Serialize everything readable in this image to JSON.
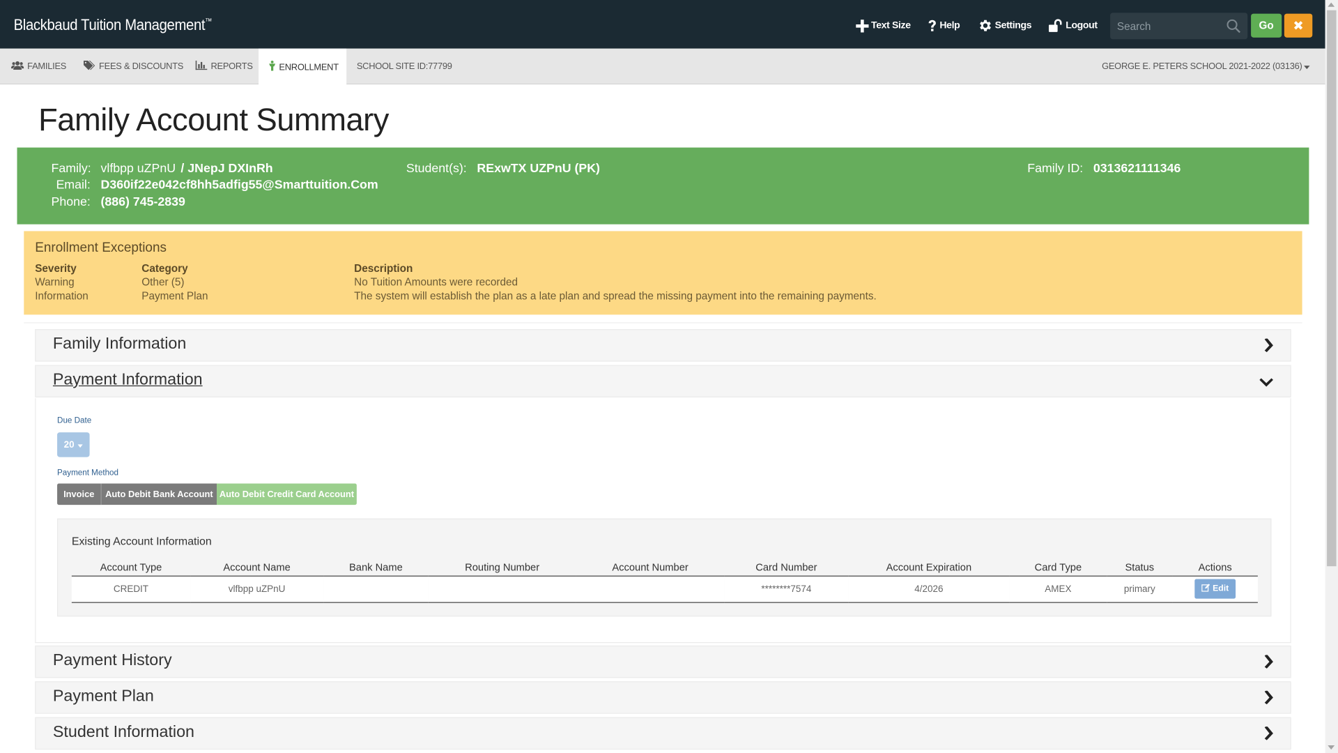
{
  "header": {
    "brand": "Blackbaud Tuition Management",
    "brand_tm": "™",
    "links": {
      "text_size": "Text Size",
      "help": "Help",
      "settings": "Settings",
      "logout": "Logout"
    },
    "search_placeholder": "Search",
    "go_label": "Go",
    "close_label": "✖"
  },
  "nav": {
    "families": "FAMILIES",
    "fees": "FEES & DISCOUNTS",
    "reports": "REPORTS",
    "enrollment": "ENROLLMENT",
    "site_id": "SCHOOL SITE ID:77799",
    "school": "GEORGE E. PETERS SCHOOL 2021-2022 (03136)"
  },
  "page_title": "Family Account Summary",
  "family": {
    "family_label": "Family:",
    "family_value_1": "vlfbpp uZPnU",
    "family_value_2": "/ JNepJ DXInRh",
    "email_label": "Email:",
    "email_value": "D360if22e042cf8hh5adfig55@Smarttuition.Com",
    "phone_label": "Phone:",
    "phone_value": "(886) 745-2839",
    "students_label": "Student(s):",
    "students_value": "RExwTX UZPnU (PK)",
    "family_id_label": "Family ID:",
    "family_id_value": "0313621111346"
  },
  "exceptions": {
    "title": "Enrollment Exceptions",
    "headers": {
      "severity": "Severity",
      "category": "Category",
      "description": "Description"
    },
    "rows": [
      {
        "severity": "Warning",
        "category": "Other (5)",
        "description": "No Tuition Amounts were recorded"
      },
      {
        "severity": "Information",
        "category": "Payment Plan",
        "description": "The system will establish the plan as a late plan and spread the missing payment into the remaining payments."
      }
    ]
  },
  "sections": {
    "family_info": "Family Information",
    "payment_info": "Payment Information",
    "payment_history": "Payment History",
    "payment_plan": "Payment Plan",
    "student_info": "Student Information"
  },
  "payment": {
    "due_date_label": "Due Date",
    "due_date_value": "20",
    "method_label": "Payment Method",
    "methods": [
      "Invoice",
      "Auto Debit Bank Account",
      "Auto Debit Credit Card Account"
    ],
    "selected_method": "Auto Debit Credit Card Account",
    "existing_title": "Existing Account Information",
    "columns": [
      "Account Type",
      "Account Name",
      "Bank Name",
      "Routing Number",
      "Account Number",
      "Card Number",
      "Account Expiration",
      "Card Type",
      "Status",
      "Actions"
    ],
    "row": {
      "account_type": "CREDIT",
      "account_name": "vlfbpp uZPnU",
      "bank_name": "",
      "routing_number": "",
      "account_number": "",
      "card_number": "********7574",
      "expiration": "4/2026",
      "card_type": "AMEX",
      "status": "primary",
      "action": "Edit"
    }
  },
  "colors": {
    "header_bg": "#1b2a33",
    "family_green": "#66ad5c",
    "exception_yellow": "#fdd985",
    "go_green": "#5fae54",
    "close_orange": "#ef9b24",
    "edit_blue": "#7fa9d7"
  },
  "icons": {
    "text_size": "plus-icon",
    "help": "question-icon",
    "settings": "gear-icon",
    "logout": "unlock-icon",
    "search": "search-icon",
    "families": "users-icon",
    "fees": "tags-icon",
    "reports": "bar-chart-icon",
    "enrollment": "child-icon",
    "collapsed": "chevron-right-icon",
    "expanded": "chevron-down-icon",
    "edit": "edit-icon"
  }
}
